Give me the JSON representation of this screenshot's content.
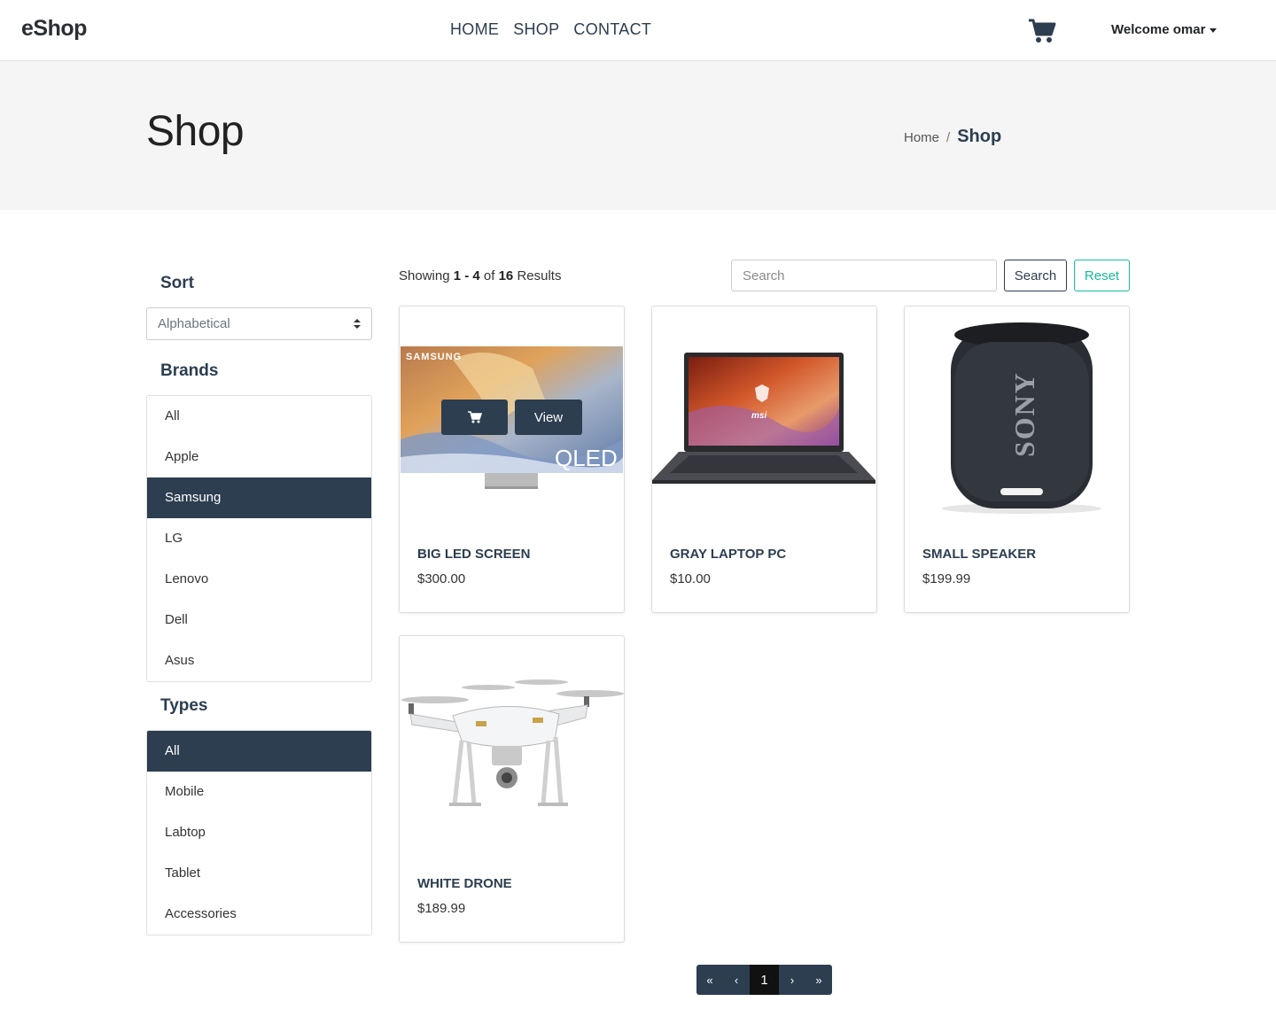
{
  "navbar": {
    "brand": "eShop",
    "links": [
      "HOME",
      "SHOP",
      "CONTACT"
    ],
    "cart_icon": "cart-icon",
    "welcome": "Welcome omar"
  },
  "header": {
    "title": "Shop",
    "breadcrumb": {
      "home": "Home",
      "separator": "/",
      "current": "Shop"
    }
  },
  "sidebar": {
    "sort_title": "Sort",
    "sort_selected": "Alphabetical",
    "brands_title": "Brands",
    "brands": [
      "All",
      "Apple",
      "Samsung",
      "LG",
      "Lenovo",
      "Dell",
      "Asus"
    ],
    "brands_active": "Samsung",
    "types_title": "Types",
    "types": [
      "All",
      "Mobile",
      "Labtop",
      "Tablet",
      "Accessories"
    ],
    "types_active": "All"
  },
  "toolbar": {
    "showing_prefix": "Showing ",
    "range": "1 - 4",
    "of": " of ",
    "total": "16",
    "results": " Results",
    "search_placeholder": "Search",
    "search_label": "Search",
    "reset_label": "Reset"
  },
  "products": [
    {
      "name": "BIG LED SCREEN",
      "price": "$300.00",
      "brand_text": "SAMSUNG",
      "model_text": "QLED",
      "view_label": "View"
    },
    {
      "name": "GRAY LAPTOP PC",
      "price": "$10.00",
      "logo_text": "msi"
    },
    {
      "name": "SMALL SPEAKER",
      "price": "$199.99",
      "logo_text": "SONY"
    },
    {
      "name": "WHITE DRONE",
      "price": "$189.99"
    }
  ],
  "pagination": {
    "first": "«",
    "prev": "‹",
    "current": "1",
    "next": "›",
    "last": "»"
  },
  "colors": {
    "primary": "#2c3e50",
    "success": "#18bc9c",
    "header_band": "#f5f5f6"
  }
}
